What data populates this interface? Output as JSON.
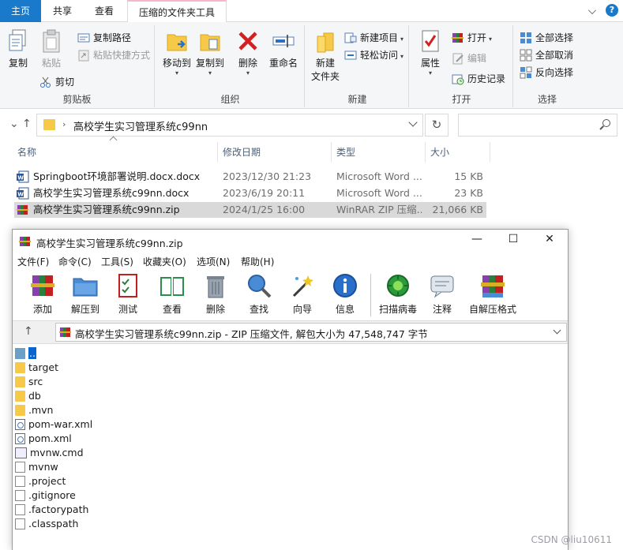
{
  "ribbon_tabs": {
    "home": "主页",
    "share": "共享",
    "view": "查看",
    "context": "压缩的文件夹工具"
  },
  "ribbon": {
    "clipboard": {
      "label": "剪贴板",
      "copy": "复制",
      "paste": "粘贴",
      "copy_path": "复制路径",
      "paste_shortcut": "粘贴快捷方式",
      "cut": "剪切"
    },
    "organize": {
      "label": "组织",
      "move_to": "移动到",
      "copy_to": "复制到",
      "delete": "删除",
      "rename": "重命名"
    },
    "new": {
      "label": "新建",
      "new_folder_line1": "新建",
      "new_folder_line2": "文件夹",
      "new_item": "新建项目",
      "easy_access": "轻松访问"
    },
    "open": {
      "label": "打开",
      "properties": "属性",
      "open": "打开",
      "edit": "编辑",
      "history": "历史记录"
    },
    "select": {
      "label": "选择",
      "select_all": "全部选择",
      "select_none": "全部取消",
      "invert": "反向选择"
    }
  },
  "address": {
    "path": "高校学生实习管理系统c99nn"
  },
  "file_list": {
    "columns": [
      "名称",
      "修改日期",
      "类型",
      "大小"
    ],
    "rows": [
      {
        "name": "Springboot环境部署说明.docx.docx",
        "date": "2023/12/30 21:23",
        "type": "Microsoft Word ...",
        "size": "15 KB",
        "icon": "word-icon"
      },
      {
        "name": "高校学生实习管理系统c99nn.docx",
        "date": "2023/6/19 20:11",
        "type": "Microsoft Word ...",
        "size": "23 KB",
        "icon": "word-icon"
      },
      {
        "name": "高校学生实习管理系统c99nn.zip",
        "date": "2024/1/25 16:00",
        "type": "WinRAR ZIP 压缩...",
        "size": "21,066 KB",
        "icon": "winrar-icon"
      }
    ]
  },
  "winrar": {
    "title": "高校学生实习管理系统c99nn.zip",
    "menu": [
      "文件(F)",
      "命令(C)",
      "工具(S)",
      "收藏夹(O)",
      "选项(N)",
      "帮助(H)"
    ],
    "toolbar": [
      "添加",
      "解压到",
      "测试",
      "查看",
      "删除",
      "查找",
      "向导",
      "信息",
      "扫描病毒",
      "注释",
      "自解压格式"
    ],
    "path": "高校学生实习管理系统c99nn.zip - ZIP 压缩文件, 解包大小为 47,548,747 字节",
    "items": [
      {
        "name": "..",
        "kind": "up"
      },
      {
        "name": "target",
        "kind": "folder"
      },
      {
        "name": "src",
        "kind": "folder"
      },
      {
        "name": "db",
        "kind": "folder"
      },
      {
        "name": ".mvn",
        "kind": "folder"
      },
      {
        "name": "pom-war.xml",
        "kind": "xml"
      },
      {
        "name": "pom.xml",
        "kind": "xml"
      },
      {
        "name": "mvnw.cmd",
        "kind": "cmd"
      },
      {
        "name": "mvnw",
        "kind": "file"
      },
      {
        "name": ".project",
        "kind": "file"
      },
      {
        "name": ".gitignore",
        "kind": "file"
      },
      {
        "name": ".factorypath",
        "kind": "file"
      },
      {
        "name": ".classpath",
        "kind": "file"
      }
    ]
  },
  "watermark": "CSDN @liu10611"
}
